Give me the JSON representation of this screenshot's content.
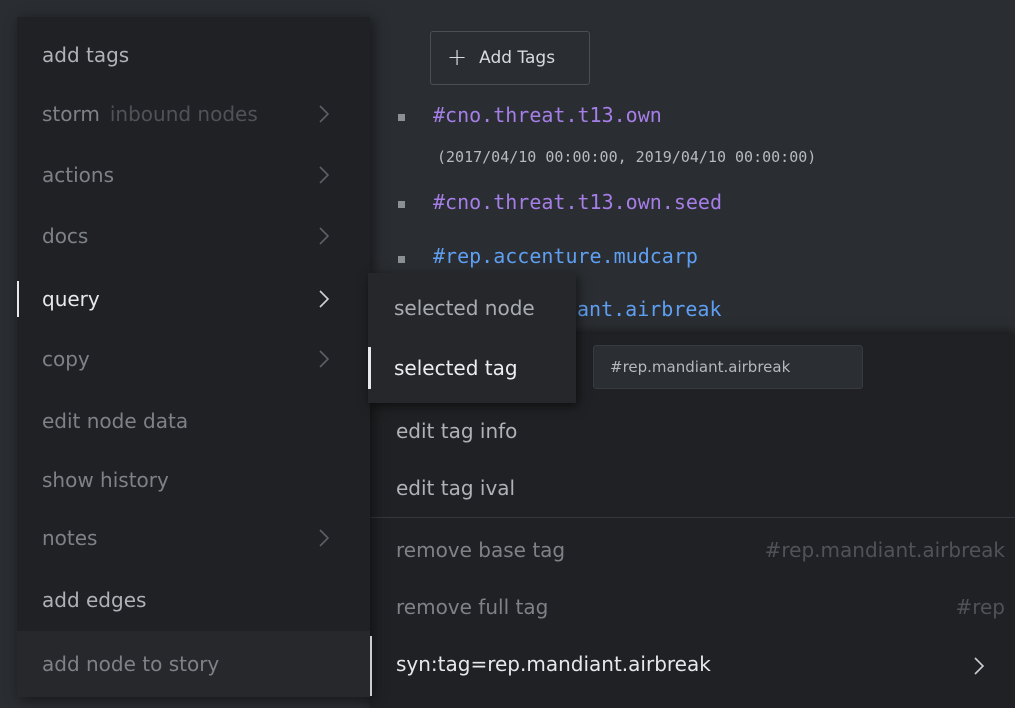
{
  "tag_panel": {
    "add_tags_label": "Add Tags",
    "tags": [
      {
        "text": "#cno.threat.t13.own",
        "color": "#a57ee8"
      },
      {
        "ival": "(2017/04/10 00:00:00, 2019/04/10 00:00:00)"
      },
      {
        "text": "#cno.threat.t13.own.seed",
        "color": "#a57ee8"
      },
      {
        "text": "#rep.accenture.mudcarp",
        "color": "#5f9ff2"
      },
      {
        "text": "ant.airbreak",
        "color": "#5f9ff2"
      }
    ]
  },
  "main_menu": {
    "items": [
      {
        "label": "add tags"
      },
      {
        "label": "storm",
        "sub": "inbound nodes"
      },
      {
        "label": "actions"
      },
      {
        "label": "docs"
      },
      {
        "label": "query"
      },
      {
        "label": "copy"
      },
      {
        "label": "edit node data"
      },
      {
        "label": "show history"
      },
      {
        "label": "notes"
      },
      {
        "label": "add edges"
      },
      {
        "label": "add node to story"
      }
    ]
  },
  "query_submenu": {
    "items": [
      {
        "label": "selected node"
      },
      {
        "label": "selected tag"
      }
    ],
    "tooltip": "#rep.mandiant.airbreak"
  },
  "tag_menu": {
    "edit_tag_info": "edit tag info",
    "edit_tag_ival": "edit tag ival",
    "remove_base_tag": "remove base tag",
    "remove_base_tag_hint": "#rep.mandiant.airbreak",
    "remove_full_tag": "remove full tag",
    "remove_full_tag_hint": "#rep",
    "syn_tag": "syn:tag=rep.mandiant.airbreak"
  },
  "icons": {
    "plus": "plus-icon",
    "chevron": "chevron-right-icon"
  }
}
